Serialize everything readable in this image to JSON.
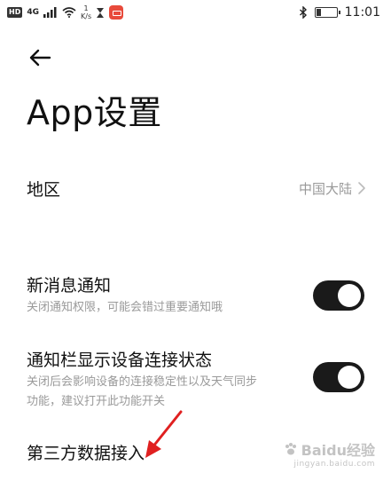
{
  "status_bar": {
    "hd": "HD",
    "network": "4G",
    "speed_value": "1",
    "speed_unit": "K/s",
    "time": "11:01",
    "battery_level": 0.25
  },
  "header": {
    "title": "App设置"
  },
  "settings": {
    "region": {
      "label": "地区",
      "value": "中国大陆"
    },
    "new_message": {
      "title": "新消息通知",
      "subtitle": "关闭通知权限，可能会错过重要通知哦",
      "enabled": true
    },
    "notification_bar": {
      "title": "通知栏显示设备连接状态",
      "subtitle_line1": "关闭后会影响设备的连接稳定性以及天气同步",
      "subtitle_line2": "功能，建议打开此功能开关",
      "enabled": true
    },
    "third_party": {
      "title": "第三方数据接入"
    }
  },
  "watermark": {
    "brand": "Baidu经验",
    "url": "jingyan.baidu.com"
  },
  "colors": {
    "toggle_on": "#1a1a1a",
    "annotation_arrow": "#e02020",
    "subtitle": "#9a9a9a"
  }
}
